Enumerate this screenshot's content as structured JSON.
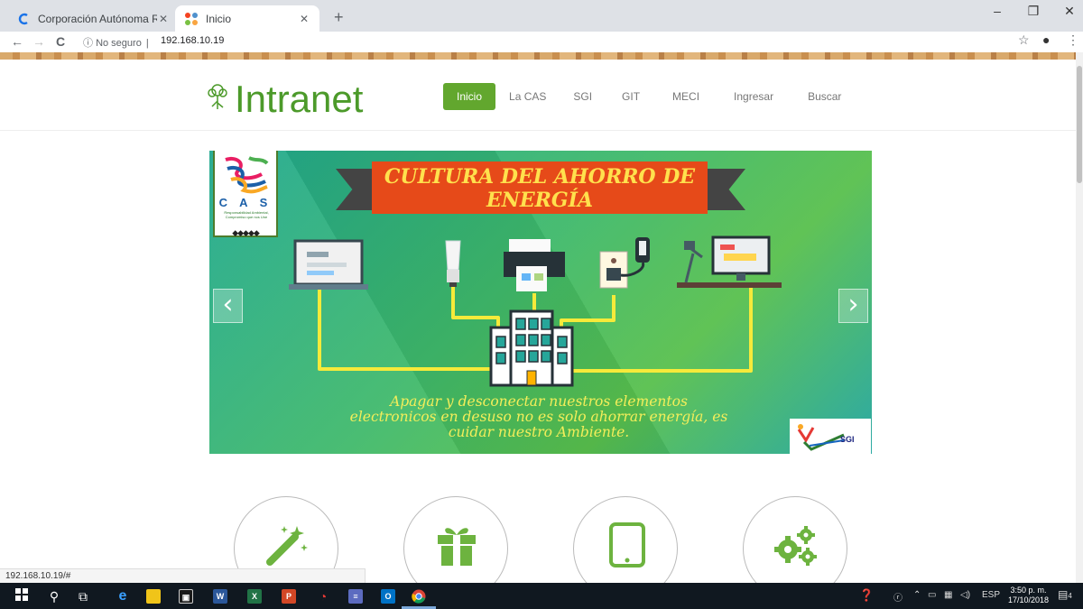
{
  "browser": {
    "tabs": [
      {
        "title": "Corporación Autónoma Regional",
        "active": false
      },
      {
        "title": "Inicio",
        "active": true
      }
    ],
    "nav": {
      "back": "←",
      "forward": "→",
      "reload": "C"
    },
    "security_label": "No seguro",
    "url": "192.168.10.19",
    "status_url": "192.168.10.19/#"
  },
  "site": {
    "logo_text": "Intranet",
    "nav": [
      "Inicio",
      "La CAS",
      "SGI",
      "GIT",
      "MECI",
      "Ingresar",
      "Buscar"
    ],
    "active_nav": "Inicio"
  },
  "banner": {
    "heading_line1": "CULTURA DEL AHORRO DE",
    "heading_line2": "ENERGÍA",
    "cas_logo_text": "C A S",
    "cas_logo_tagline": "Responsabilidad Ambiental, Compromiso que nos Une",
    "message_line1": "Apagar y desconectar nuestros elementos",
    "message_line2": "electronicos en desuso no es solo  ahorrar energía, es",
    "message_line3": "cuidar nuestro Ambiente.",
    "sgi_label": "SGI",
    "prev_label": "‹",
    "next_label": "›"
  },
  "features": [
    {
      "icon": "magic-wand-icon"
    },
    {
      "icon": "gift-icon"
    },
    {
      "icon": "tablet-icon"
    },
    {
      "icon": "gears-icon"
    }
  ],
  "taskbar": {
    "language": "ESP",
    "time": "3:50 p. m.",
    "date": "17/10/2018",
    "notification_count": "4"
  },
  "colors": {
    "brand_green": "#62a72e",
    "logo_green": "#4c9a2a",
    "ribbon_orange": "#e64a19",
    "ribbon_text": "#ffe14d"
  }
}
